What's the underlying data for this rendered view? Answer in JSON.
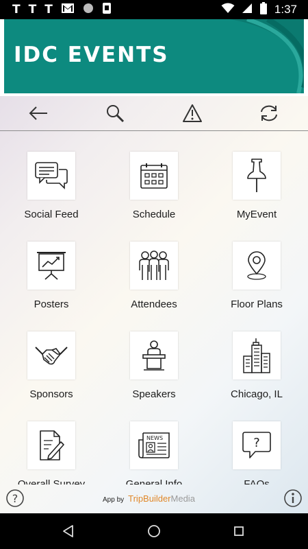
{
  "status_bar": {
    "left_icons": [
      "T",
      "T",
      "T",
      "gmail-icon",
      "circle-icon",
      "phone-icon"
    ],
    "notif_letters": [
      "T",
      "T",
      "T"
    ],
    "time": "1:37",
    "right_icons": [
      "wifi-icon",
      "cellular-icon",
      "battery-icon"
    ]
  },
  "banner": {
    "title": "IDC EVENTS",
    "color": "#0d8a7f"
  },
  "toolbar": {
    "icons": [
      "back-arrow-icon",
      "search-icon",
      "warning-icon",
      "sync-icon"
    ]
  },
  "menu": {
    "items": [
      {
        "label": "Social Feed",
        "icon": "chat-bubbles-icon"
      },
      {
        "label": "Schedule",
        "icon": "calendar-icon"
      },
      {
        "label": "MyEvent",
        "icon": "pushpin-icon"
      },
      {
        "label": "Posters",
        "icon": "presentation-board-icon"
      },
      {
        "label": "Attendees",
        "icon": "people-group-icon"
      },
      {
        "label": "Floor Plans",
        "icon": "map-pin-icon"
      },
      {
        "label": "Sponsors",
        "icon": "handshake-icon"
      },
      {
        "label": "Speakers",
        "icon": "podium-speaker-icon"
      },
      {
        "label": "Chicago, IL",
        "icon": "city-buildings-icon"
      },
      {
        "label": "Overall Survey",
        "icon": "survey-edit-icon"
      },
      {
        "label": "General Info",
        "icon": "newspaper-icon"
      },
      {
        "label": "FAQs",
        "icon": "question-bubble-icon"
      }
    ]
  },
  "footer": {
    "powered_prefix": "App by",
    "brand_part1": "TripBuilder",
    "brand_part2": "Media",
    "brand_color": "#e0882a",
    "left_icon": "help-icon",
    "right_icon": "info-icon"
  },
  "nav_bar": {
    "icons": [
      "back-triangle-icon",
      "home-circle-icon",
      "recents-square-icon"
    ]
  }
}
